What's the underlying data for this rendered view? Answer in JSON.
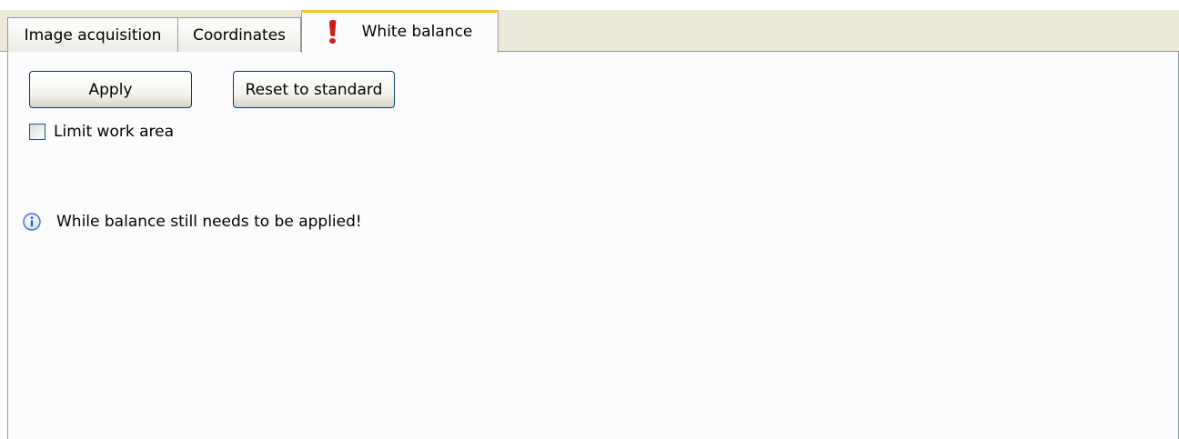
{
  "tabs": [
    {
      "label": "Image acquisition",
      "active": false
    },
    {
      "label": "Coordinates",
      "active": false
    },
    {
      "label": "White balance",
      "active": true,
      "icon": "warning-exclamation-icon"
    }
  ],
  "buttons": {
    "apply_label": "Apply",
    "reset_label": "Reset to standard"
  },
  "checkbox": {
    "label": "Limit work area",
    "checked": false
  },
  "info": {
    "icon": "info-icon",
    "message": "While balance still needs to be applied!"
  },
  "colors": {
    "active_tab_accent": "#f7c03c",
    "warning_icon": "#d01e14",
    "info_icon": "#3a6fd8",
    "button_border": "#003c74"
  }
}
